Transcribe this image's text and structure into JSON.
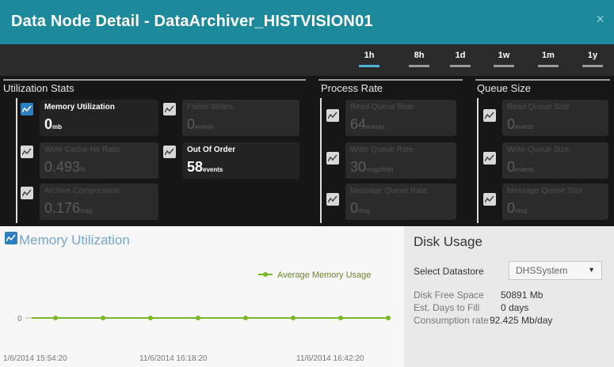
{
  "window": {
    "title": "Data Node Detail - DataArchiver_HISTVISION01",
    "close_glyph": "×"
  },
  "ranges": [
    {
      "label": "1h",
      "active": true
    },
    {
      "label": "8h",
      "active": false
    },
    {
      "label": "1d",
      "active": false
    },
    {
      "label": "1w",
      "active": false
    },
    {
      "label": "1m",
      "active": false
    },
    {
      "label": "1y",
      "active": false
    }
  ],
  "sections": {
    "utilization": "Utilization Stats",
    "process": "Process Rate",
    "queue": "Queue Size"
  },
  "tiles": {
    "memory": {
      "label": "Memory Utilization",
      "value": "0",
      "unit": "mb"
    },
    "failed": {
      "label": "Failed Writes",
      "value": "0",
      "unit": "events"
    },
    "cache": {
      "label": "Write Cache Hit Ratio",
      "value": "0.493",
      "unit": "%"
    },
    "outoforder": {
      "label": "Out Of Order",
      "value": "58",
      "unit": "events"
    },
    "compression": {
      "label": "Archive Compression",
      "value": "0.176",
      "unit": "msg"
    },
    "readrate": {
      "label": "Read Queue Rate",
      "value": "64",
      "unit": "events"
    },
    "writerate": {
      "label": "Write Queue Rate",
      "value": "30",
      "unit": "msgs/min"
    },
    "msgrate": {
      "label": "Message Queue Rate",
      "value": "0",
      "unit": "msg"
    },
    "readsize": {
      "label": "Read Queue Size",
      "value": "0",
      "unit": "events"
    },
    "writesize": {
      "label": "Write Queue Size",
      "value": "0",
      "unit": "events"
    },
    "msgsize": {
      "label": "Message Queue Size",
      "value": "0",
      "unit": "msg"
    }
  },
  "chart_panel": {
    "title": "Memory Utilization"
  },
  "chart_data": {
    "type": "line",
    "title": "Memory Utilization",
    "series": [
      {
        "name": "Average Memory Usage",
        "values": [
          0,
          0,
          0,
          0,
          0,
          0,
          0,
          0,
          0,
          0,
          0,
          0,
          0,
          0,
          0,
          0
        ],
        "color": "#7ab829"
      }
    ],
    "x_ticks": [
      "1/6/2014 15:54:20",
      "11/6/2014 16:18:20",
      "11/6/2014 16:42:20"
    ],
    "y_ticks": [
      "0"
    ],
    "grid": false,
    "legend_position": "top-right"
  },
  "disk": {
    "title": "Disk Usage",
    "select_label": "Select Datastore",
    "select_value": "DHSSystem",
    "select_arrow": "▼",
    "free_label": "Disk Free Space",
    "free_value": "50891 Mb",
    "days_label": "Est. Days to Fill",
    "days_value": "0 days",
    "rate_label": "Consumption rate",
    "rate_value": "92.425 Mb/day"
  },
  "colors": {
    "header": "#1d8a9b",
    "accent_blue": "#2c7fc0",
    "line_green": "#7ab829"
  }
}
